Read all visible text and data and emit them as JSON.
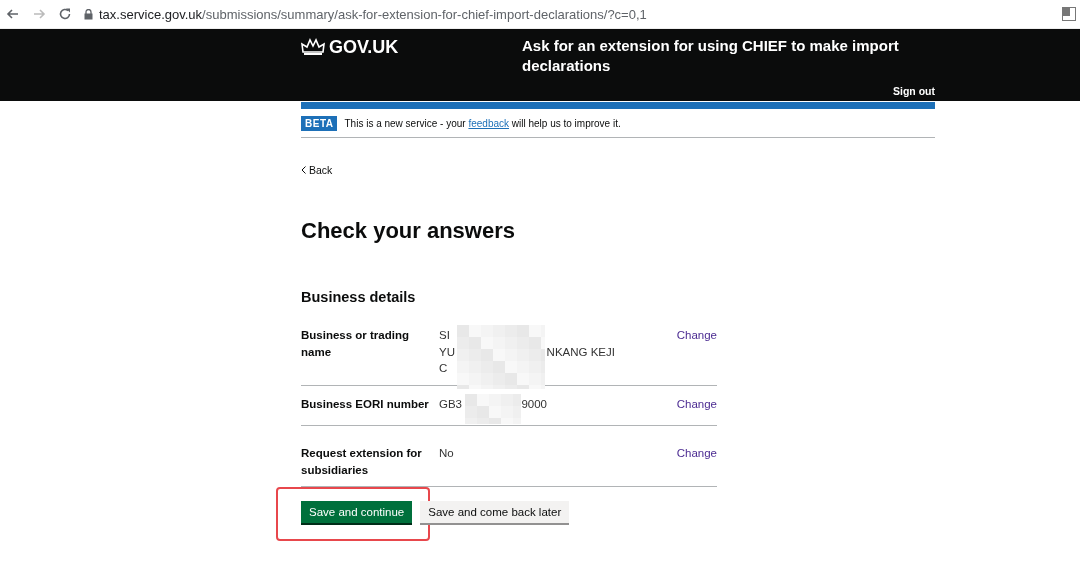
{
  "browser": {
    "url_host": "tax.service.gov.uk",
    "url_path": "/submissions/summary/ask-for-extension-for-chief-import-declarations/?c=0,1"
  },
  "header": {
    "logo": "GOV.UK",
    "service_name": "Ask for an extension for using CHIEF to make import declarations",
    "sign_out": "Sign out"
  },
  "phase_banner": {
    "tag": "BETA",
    "text_before": "This is a new service - your",
    "link": "feedback",
    "text_after": "will help us to improve it."
  },
  "back_link": "Back",
  "heading": "Check your answers",
  "section_title": "Business details",
  "rows": [
    {
      "key": "Business or trading name",
      "redacted": true,
      "value_lines": [
        [
          "SI"
        ],
        [
          "YU",
          "NKANG KEJI"
        ],
        [
          "C"
        ]
      ],
      "action": "Change"
    },
    {
      "key": "Business EORI number",
      "redacted": true,
      "value_lines": [
        [
          "GB3",
          "9000"
        ]
      ],
      "action": "Change"
    },
    {
      "key": "Request extension for subsidiaries",
      "redacted": false,
      "value_lines": [
        [
          "No"
        ]
      ],
      "action": "Change"
    }
  ],
  "buttons": [
    {
      "label": "Save and continue",
      "kind": "primary",
      "highlighted": true
    },
    {
      "label": "Save and come back later",
      "kind": "secondary",
      "highlighted": false
    }
  ]
}
